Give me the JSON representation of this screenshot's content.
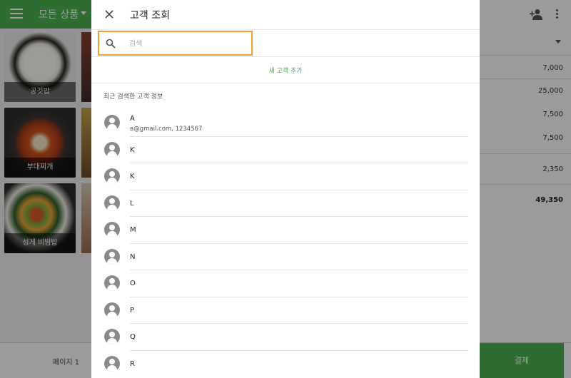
{
  "background": {
    "category_title": "모든 상품",
    "tiles": [
      {
        "label": "공깃밥"
      },
      {
        "label": "부대찌개"
      },
      {
        "label": "성게 비빔밥"
      }
    ],
    "order_prices": [
      "7,000",
      "25,000",
      "7,500",
      "7,500",
      "2,350"
    ],
    "order_total": "49,350",
    "page_label": "페이지 1",
    "pay_label": "결제",
    "accent": "#4caf50"
  },
  "dialog": {
    "title": "고객 조회",
    "search": {
      "placeholder": "검색",
      "value": ""
    },
    "new_customer_label": "새 고객 추가",
    "recent_heading": "최근 검색한 고객 정보",
    "focus_color": "#f5a034",
    "customers": [
      {
        "name": "A",
        "detail": "a@gmail.com, 1234567"
      },
      {
        "name": "K"
      },
      {
        "name": "K"
      },
      {
        "name": "L"
      },
      {
        "name": "M"
      },
      {
        "name": "N"
      },
      {
        "name": "O"
      },
      {
        "name": "P"
      },
      {
        "name": "Q"
      },
      {
        "name": "R"
      }
    ]
  }
}
